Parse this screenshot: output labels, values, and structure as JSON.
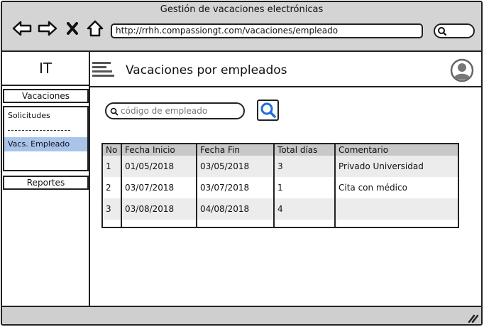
{
  "window": {
    "title": "Gestión de vacaciones electrónicas"
  },
  "browser": {
    "url": "http://rrhh.compassiongt.com/vacaciones/empleado",
    "nav_icons": [
      "back-arrow-icon",
      "forward-arrow-icon",
      "close-icon",
      "home-icon"
    ]
  },
  "sidebar": {
    "brand": "IT",
    "vacaciones_header": "Vacaciones",
    "items": [
      {
        "label": "Solicitudes"
      },
      {
        "label": "Vacs. Empleado"
      }
    ],
    "reportes_header": "Reportes"
  },
  "header": {
    "title": "Vacaciones por empleados"
  },
  "search": {
    "placeholder": "código de empleado",
    "value": ""
  },
  "table": {
    "columns": [
      "No",
      "Fecha Inicio",
      "Fecha Fin",
      "Total días",
      "Comentario"
    ],
    "rows": [
      [
        "1",
        "01/05/2018",
        "03/05/2018",
        "3",
        "Privado Universidad"
      ],
      [
        "2",
        "03/07/2018",
        "03/07/2018",
        "1",
        "Cita con médico"
      ],
      [
        "3",
        "03/08/2018",
        "04/08/2018",
        "4",
        ""
      ]
    ]
  },
  "colors": {
    "chrome": "#d4d4d4",
    "selected_item": "#a9c4eb",
    "search_icon": "#1e6fd9",
    "header_row": "#c8c8c8"
  }
}
